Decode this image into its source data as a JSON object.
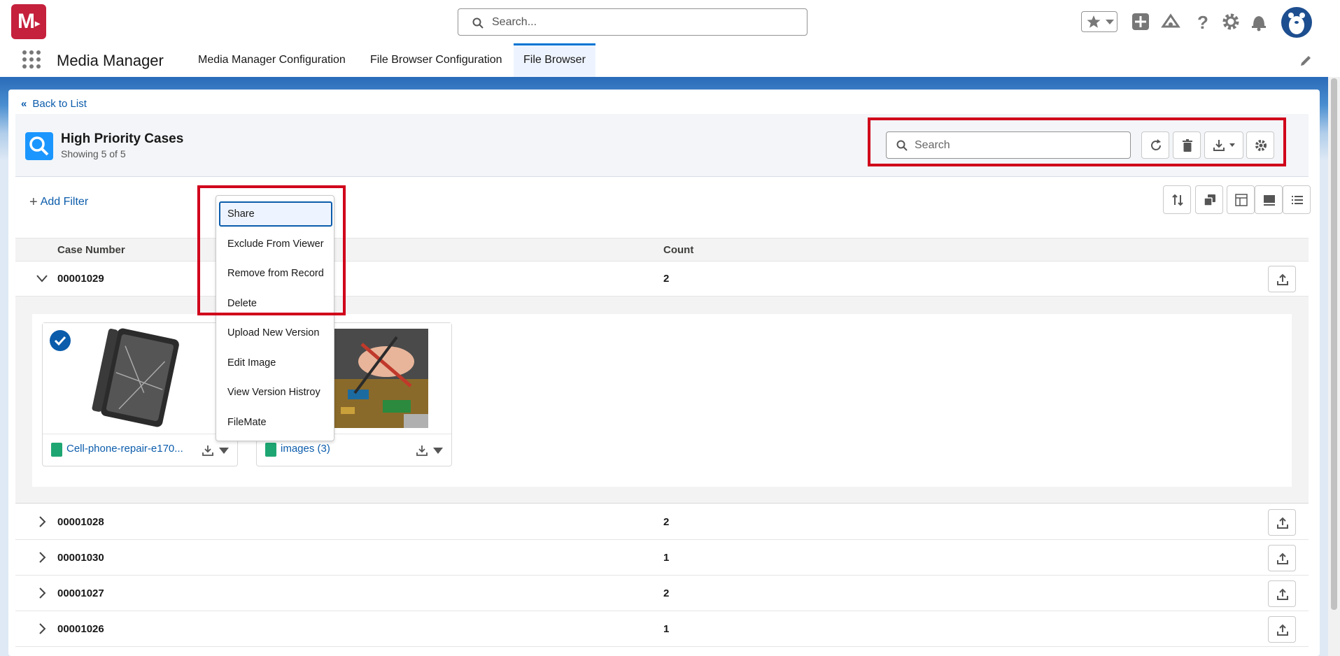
{
  "global_header": {
    "logo_text": "M",
    "search_placeholder": "Search..."
  },
  "app_nav": {
    "app_name": "Media Manager",
    "tabs": [
      {
        "label": "Media Manager Configuration",
        "active": false
      },
      {
        "label": "File Browser Configuration",
        "active": false
      },
      {
        "label": "File Browser",
        "active": true
      }
    ]
  },
  "list_view": {
    "back_link": "Back to List",
    "title": "High Priority Cases",
    "subtitle": "Showing 5 of 5",
    "search_placeholder": "Search",
    "add_filter": "Add Filter"
  },
  "table": {
    "columns": [
      "Case Number",
      "Count"
    ],
    "rows": [
      {
        "case_number": "00001029",
        "count": "2",
        "expanded": true
      },
      {
        "case_number": "00001028",
        "count": "2",
        "expanded": false
      },
      {
        "case_number": "00001030",
        "count": "1",
        "expanded": false
      },
      {
        "case_number": "00001027",
        "count": "2",
        "expanded": false
      },
      {
        "case_number": "00001026",
        "count": "1",
        "expanded": false
      }
    ]
  },
  "files": [
    {
      "name": "Cell-phone-repair-e170...",
      "selected": true
    },
    {
      "name": "images (3)",
      "selected": false
    }
  ],
  "context_menu": {
    "items": [
      "Share",
      "Exclude From Viewer",
      "Remove from Record",
      "Delete",
      "Upload New Version",
      "Edit Image",
      "View Version Histroy",
      "FileMate"
    ],
    "focused": "Share"
  },
  "colors": {
    "brand": "#c5203c",
    "accent": "#0176d3",
    "highlight_border": "#d0021b",
    "link": "#0b5cab"
  }
}
